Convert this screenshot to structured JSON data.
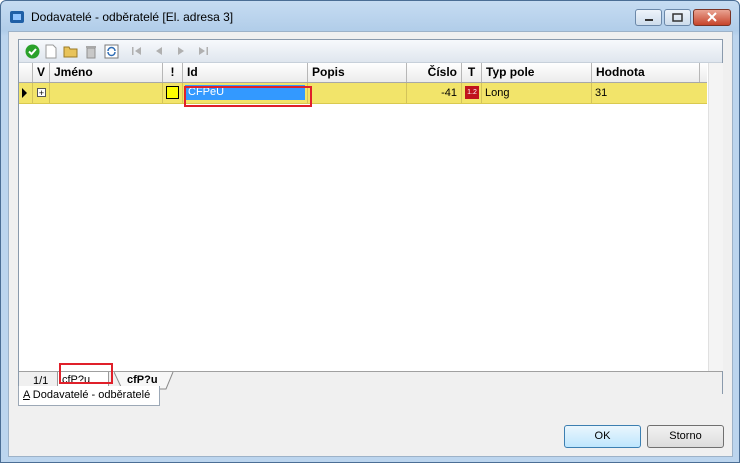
{
  "window": {
    "title": "Dodavatelé - odběratelé [El. adresa 3]"
  },
  "grid": {
    "columns": {
      "v": "V",
      "name": "Jméno",
      "excl": "!",
      "id": "Id",
      "desc": "Popis",
      "number": "Číslo",
      "type_flag": "T",
      "field_type": "Typ pole",
      "value": "Hodnota"
    },
    "rows": [
      {
        "expand": "+",
        "name": "",
        "id": "CFPeU",
        "desc": "",
        "number": "-41",
        "type_badge": "1.2",
        "field_type": "Long",
        "value": "31"
      }
    ]
  },
  "tabs": {
    "position": "1/1",
    "active": "cfP?u",
    "other": "cfP?u"
  },
  "bottom_tab": {
    "hotkey": "A",
    "label": " Dodavatelé - odběratelé"
  },
  "buttons": {
    "ok": "OK",
    "cancel": "Storno"
  },
  "colors": {
    "row_highlight": "#f2e46a",
    "selected_cell": "#3399ff",
    "annotation": "#e0202a",
    "confirm_icon": "#2aa12a"
  },
  "icons": [
    "app-icon",
    "confirm-icon",
    "new-icon",
    "open-icon",
    "delete-icon",
    "refresh-icon",
    "first-icon",
    "prev-icon",
    "next-icon",
    "last-icon"
  ]
}
